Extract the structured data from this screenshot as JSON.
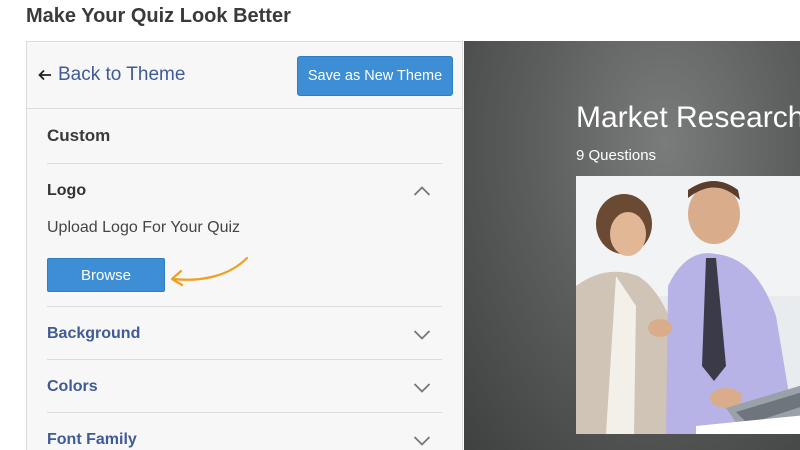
{
  "page": {
    "title": "Make Your Quiz Look Better"
  },
  "editor": {
    "back_label": "Back to Theme",
    "save_label": "Save as New Theme",
    "custom_label": "Custom",
    "sections": {
      "logo": {
        "label": "Logo",
        "expanded": true,
        "upload_text": "Upload Logo For Your Quiz",
        "browse_label": "Browse"
      },
      "background": {
        "label": "Background",
        "expanded": false
      },
      "colors": {
        "label": "Colors",
        "expanded": false
      },
      "font_family": {
        "label": "Font Family",
        "expanded": false
      }
    }
  },
  "preview": {
    "quiz_title": "Market Research",
    "question_count": "9 Questions"
  },
  "colors": {
    "accent": "#3d8ed4",
    "link": "#3f5b96",
    "annotation": "#f0a020"
  }
}
